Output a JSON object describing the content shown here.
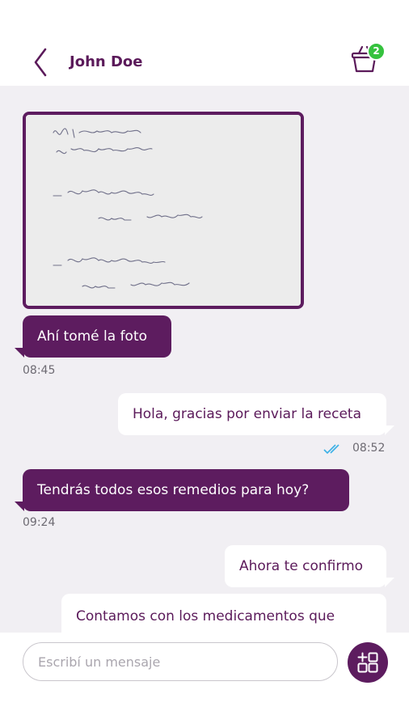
{
  "header": {
    "contact_name": "John Doe",
    "cart_count": "2",
    "back_icon": "chevron-left-icon",
    "cart_icon": "basket-icon"
  },
  "messages": [
    {
      "type": "image",
      "direction": "incoming",
      "content": "handwritten prescription photo"
    },
    {
      "direction": "incoming",
      "text": "Ahí tomé la foto",
      "time": "08:45"
    },
    {
      "direction": "outgoing",
      "text": "Hola, gracias por enviar la receta",
      "time": "08:52",
      "status": "read"
    },
    {
      "direction": "incoming",
      "text": "Tendrás todos esos remedios para hoy?",
      "time": "09:24"
    },
    {
      "direction": "outgoing",
      "text": "Ahora te confirmo"
    },
    {
      "direction": "outgoing",
      "text": "Contamos con los medicamentos que"
    }
  ],
  "composer": {
    "placeholder": "Escribí un mensaje",
    "action_icon": "grid-plus-icon"
  },
  "colors": {
    "brand_purple": "#5d1c5f",
    "badge_green": "#35c23e",
    "chat_background": "#f1eff3",
    "read_ticks": "#3ab0e6"
  }
}
